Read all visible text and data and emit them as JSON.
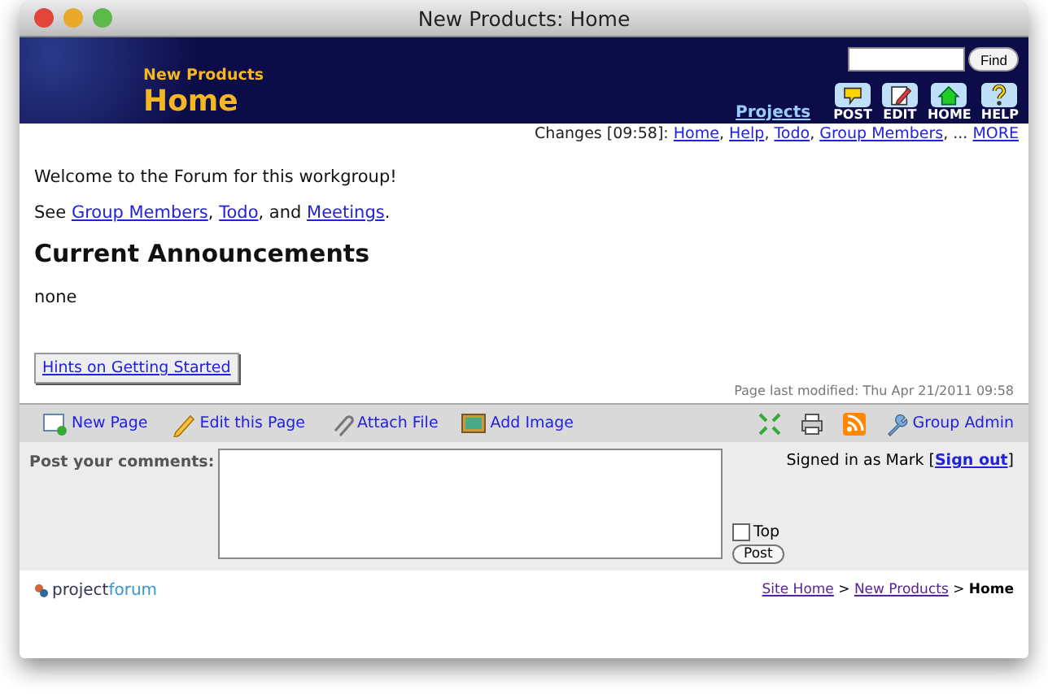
{
  "window": {
    "title": "New Products: Home"
  },
  "header": {
    "group": "New Products",
    "page": "Home",
    "find_button": "Find",
    "projects_link": "Projects",
    "nav_buttons": [
      {
        "kind": "post",
        "label": "POST"
      },
      {
        "kind": "edit",
        "label": "EDIT"
      },
      {
        "kind": "home",
        "label": "HOME"
      },
      {
        "kind": "help",
        "label": "HELP"
      }
    ]
  },
  "changes": [
    {
      "kind": "text",
      "text": "Changes [09:58]: "
    },
    {
      "kind": "link",
      "text": "Home"
    },
    {
      "kind": "text",
      "text": ", "
    },
    {
      "kind": "link",
      "text": "Help"
    },
    {
      "kind": "text",
      "text": ", "
    },
    {
      "kind": "link",
      "text": "Todo"
    },
    {
      "kind": "text",
      "text": ", "
    },
    {
      "kind": "link",
      "text": "Group Members"
    },
    {
      "kind": "text",
      "text": ", ... "
    },
    {
      "kind": "link",
      "text": "MORE"
    }
  ],
  "content": {
    "welcome": "Welcome to the Forum for this workgroup!",
    "see": {
      "lead": "See ",
      "links": [
        {
          "text": "Group Members",
          "after": ", "
        },
        {
          "text": "Todo",
          "after": ", and "
        },
        {
          "text": "Meetings",
          "after": "."
        }
      ]
    },
    "heading": "Current Announcements",
    "announcement": "none",
    "hints_button": "Hints on Getting Started",
    "last_modified": "Page last modified: Thu Apr 21/2011 09:58"
  },
  "toolbar": {
    "actions": [
      {
        "kind": "new",
        "label": "New Page"
      },
      {
        "kind": "edit",
        "label": "Edit this Page"
      },
      {
        "kind": "attach",
        "label": "Attach File"
      },
      {
        "kind": "image",
        "label": "Add Image"
      }
    ],
    "tools": [
      {
        "kind": "expand"
      },
      {
        "kind": "print"
      },
      {
        "kind": "rss"
      }
    ],
    "admin": "Group Admin"
  },
  "comments": {
    "label": "Post your comments:",
    "top_checkbox": {
      "label": "Top",
      "checked": false
    },
    "post_button": "Post",
    "signed_in": [
      {
        "kind": "text",
        "text": "Signed in as Mark ["
      },
      {
        "kind": "link",
        "text": "Sign out"
      },
      {
        "kind": "text",
        "text": "]"
      }
    ]
  },
  "footer": {
    "logo": [
      "project",
      "forum"
    ],
    "breadcrumb": [
      {
        "kind": "link",
        "text": "Site Home"
      },
      {
        "kind": "text",
        "text": " > "
      },
      {
        "kind": "link",
        "text": "New Products"
      },
      {
        "kind": "text",
        "text": " > "
      },
      {
        "kind": "current",
        "text": "Home"
      }
    ]
  }
}
